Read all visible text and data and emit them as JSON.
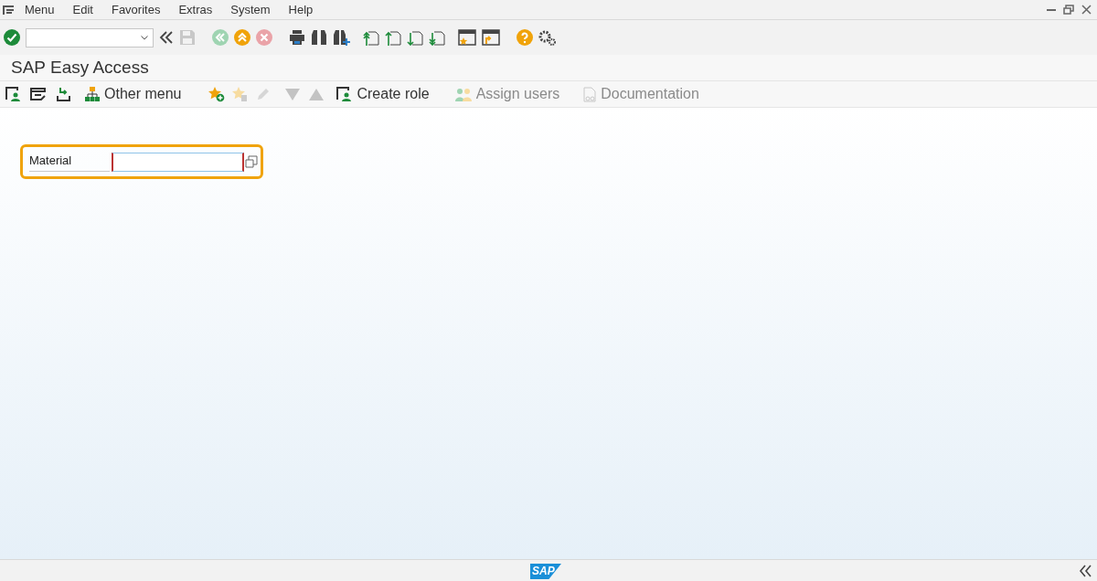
{
  "menu_bar": {
    "items": [
      "Menu",
      "Edit",
      "Favorites",
      "Extras",
      "System",
      "Help"
    ]
  },
  "title": "SAP Easy Access",
  "app_toolbar": [
    {
      "label": "Other menu",
      "disabled": false
    },
    {
      "label": "Create role",
      "disabled": false
    },
    {
      "label": "Assign users",
      "disabled": true
    },
    {
      "label": "Documentation",
      "disabled": true
    }
  ],
  "form": {
    "label": "Material"
  },
  "status_bar": {
    "logo": "SAP"
  }
}
